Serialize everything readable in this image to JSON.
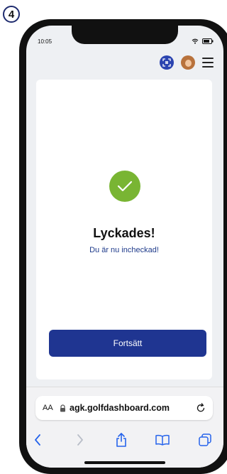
{
  "step_number": "4",
  "status_bar": {
    "time": "10:05"
  },
  "card": {
    "title": "Lyckades!",
    "subtitle": "Du är nu incheckad!",
    "continue_label": "Fortsätt"
  },
  "browser": {
    "text_size_label": "AA",
    "domain": "agk.golfdashboard.com"
  },
  "colors": {
    "primary": "#1f3591",
    "success": "#79b533",
    "link_text": "#1e3a8a"
  }
}
